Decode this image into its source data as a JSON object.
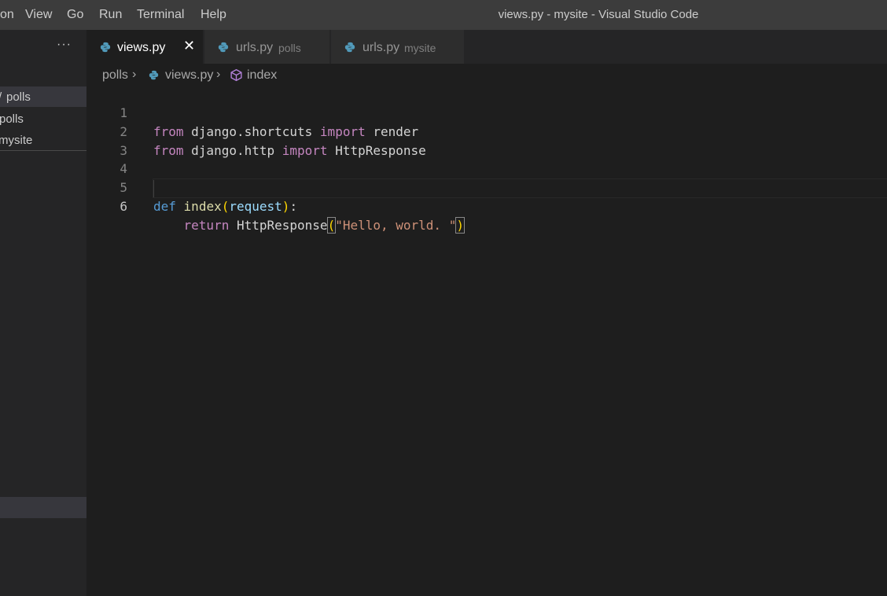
{
  "menu": {
    "items": [
      "on",
      "View",
      "Go",
      "Run",
      "Terminal",
      "Help"
    ]
  },
  "window_title": "views.py - mysite - Visual Studio Code",
  "sidebar": {
    "more_label": "···",
    "open_editors": [
      {
        "label": "polls",
        "marker": "/"
      },
      {
        "label": "polls"
      },
      {
        "label": "mysite"
      }
    ]
  },
  "tabs": [
    {
      "name": "views.py",
      "description": "",
      "active": true,
      "close": "✕"
    },
    {
      "name": "urls.py",
      "description": "polls",
      "active": false
    },
    {
      "name": "urls.py",
      "description": "mysite",
      "active": false
    }
  ],
  "breadcrumb": {
    "folder": "polls",
    "file": "views.py",
    "symbol": "index",
    "separator": "›"
  },
  "editor": {
    "line_numbers": [
      "1",
      "2",
      "3",
      "4",
      "5",
      "6"
    ],
    "current_line": "6",
    "lines": [
      {
        "kw1": "from",
        "mod": " django.shortcuts ",
        "kw2": "import",
        "name": " render"
      },
      {
        "kw1": "from",
        "mod": " django.http ",
        "kw2": "import",
        "name": " HttpResponse"
      },
      {},
      {},
      {
        "def": "def",
        "fn": "index",
        "open": "(",
        "param": "request",
        "close": ")",
        "colon": ":"
      },
      {
        "indent": "    ",
        "ret": "return",
        "call": " HttpResponse",
        "open": "(",
        "str": "\"Hello, world. \"",
        "close": ")"
      }
    ]
  },
  "colors": {
    "keyword_control": "#c586c0",
    "keyword_def": "#569cd6",
    "function": "#dcdcaa",
    "parameter": "#9cdcfe",
    "string": "#ce9178",
    "bracket": "#ffd700",
    "editor_bg": "#1e1e1e",
    "titlebar_bg": "#3c3c3c"
  }
}
